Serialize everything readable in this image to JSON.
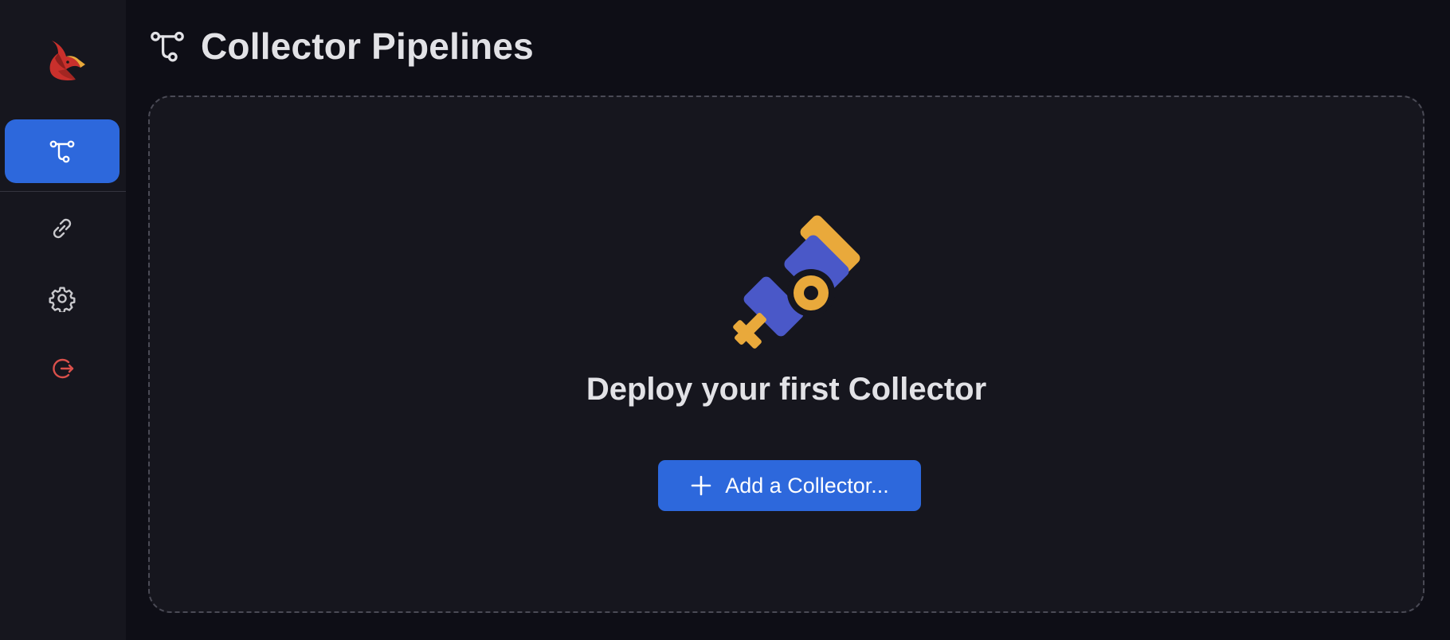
{
  "page": {
    "title": "Collector Pipelines"
  },
  "sidebar": {
    "items": [
      {
        "name": "pipelines",
        "icon": "pipeline-icon",
        "active": true
      },
      {
        "name": "links",
        "icon": "link-icon",
        "active": false
      },
      {
        "name": "settings",
        "icon": "gear-icon",
        "active": false
      },
      {
        "name": "logout",
        "icon": "logout-icon",
        "active": false
      }
    ]
  },
  "empty_state": {
    "title": "Deploy your first Collector",
    "button_label": "Add a Collector..."
  },
  "colors": {
    "background": "#0e0e16",
    "surface": "#16161e",
    "accent": "#2d68dc",
    "text": "#e2e2e6",
    "illustration_blue": "#4a58c8",
    "illustration_yellow": "#e9a93b",
    "logout_red": "#d9504b",
    "logo_red": "#c9302c"
  }
}
